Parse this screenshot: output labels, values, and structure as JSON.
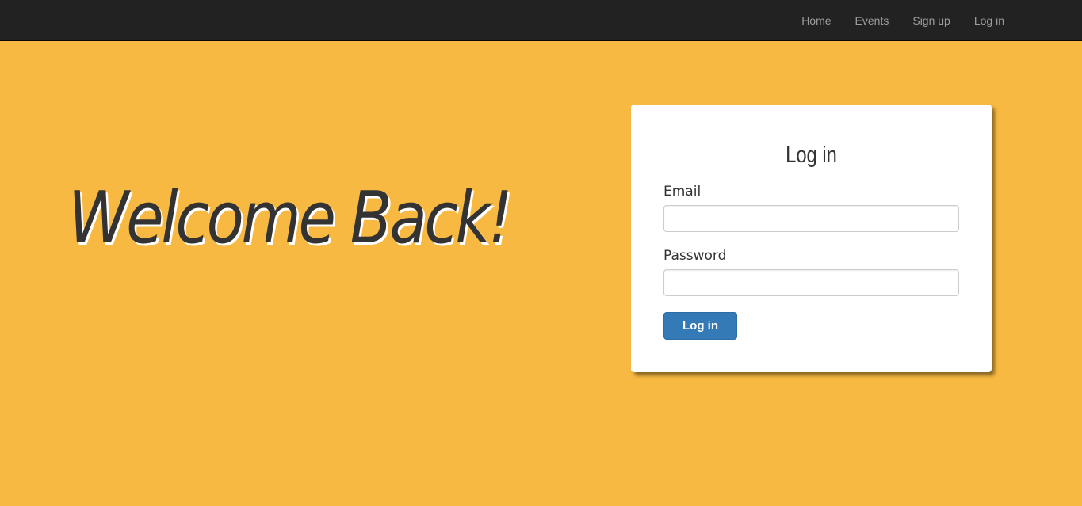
{
  "nav": {
    "items": [
      {
        "label": "Home"
      },
      {
        "label": "Events"
      },
      {
        "label": "Sign up"
      },
      {
        "label": "Log in"
      }
    ]
  },
  "hero": {
    "title": "Welcome Back!"
  },
  "login_card": {
    "title": "Log in",
    "email_label": "Email",
    "email_value": "",
    "password_label": "Password",
    "password_value": "",
    "submit_label": "Log in"
  },
  "colors": {
    "background": "#f7b942",
    "navbar": "#222222",
    "nav_link": "#9d9d9d",
    "primary_button": "#337ab7",
    "text": "#333333"
  }
}
